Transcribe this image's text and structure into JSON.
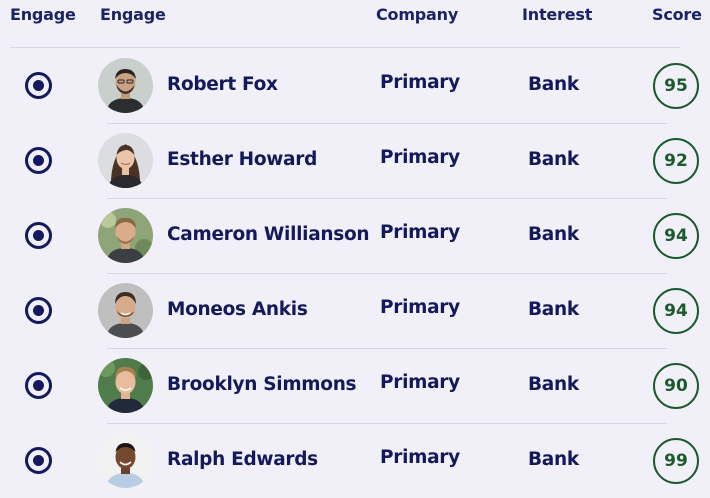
{
  "header": {
    "engage_select": "Engage",
    "engage": "Engage",
    "company": "Company",
    "interest": "Interest",
    "score": "Score"
  },
  "rows": [
    {
      "name": "Robert Fox",
      "company": "Primary",
      "interest": "Bank",
      "score": "95",
      "avatar_icon": "user-avatar-icon"
    },
    {
      "name": "Esther Howard",
      "company": "Primary",
      "interest": "Bank",
      "score": "92",
      "avatar_icon": "user-avatar-icon"
    },
    {
      "name": "Cameron Willianson",
      "company": "Primary",
      "interest": "Bank",
      "score": "94",
      "avatar_icon": "user-avatar-icon"
    },
    {
      "name": "Moneos Ankis",
      "company": "Primary",
      "interest": "Bank",
      "score": "94",
      "avatar_icon": "user-avatar-icon"
    },
    {
      "name": "Brooklyn Simmons",
      "company": "Primary",
      "interest": "Bank",
      "score": "90",
      "avatar_icon": "user-avatar-icon"
    },
    {
      "name": "Ralph Edwards",
      "company": "Primary",
      "interest": "Bank",
      "score": "99",
      "avatar_icon": "user-avatar-icon"
    }
  ],
  "colors": {
    "background": "#f1f0f8",
    "text": "#13195a",
    "radio": "#14195d",
    "score": "#1c5a2c",
    "divider": "#d7d6e2"
  }
}
